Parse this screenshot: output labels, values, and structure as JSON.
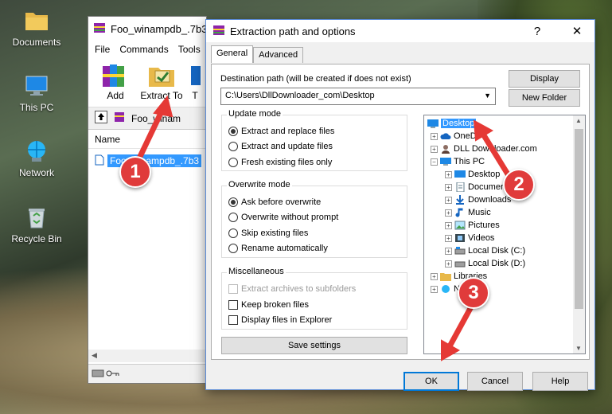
{
  "desktop": {
    "icons": [
      {
        "label": "Documents",
        "icon": "folder-documents-icon"
      },
      {
        "label": "This PC",
        "icon": "computer-icon"
      },
      {
        "label": "Network",
        "icon": "network-icon"
      },
      {
        "label": "Recycle Bin",
        "icon": "recycle-bin-icon"
      }
    ]
  },
  "winrar": {
    "title": "Foo_winampdb_.7b3",
    "menu": [
      "File",
      "Commands",
      "Tools"
    ],
    "toolbar": [
      {
        "label": "Add"
      },
      {
        "label": "Extract To"
      },
      {
        "label": "T"
      }
    ],
    "path": "Foo_winam",
    "column_name": "Name",
    "file": "Foo_winampdb_.7b3"
  },
  "dialog": {
    "title": "Extraction path and options",
    "help": "?",
    "close": "✕",
    "tabs": [
      "General",
      "Advanced"
    ],
    "dest_label": "Destination path (will be created if does not exist)",
    "dest_value": "C:\\Users\\DllDownloader_com\\Desktop",
    "display_btn": "Display",
    "new_folder_btn": "New Folder",
    "update_mode": {
      "title": "Update mode",
      "options": [
        "Extract and replace files",
        "Extract and update files",
        "Fresh existing files only"
      ],
      "selected": 0
    },
    "overwrite_mode": {
      "title": "Overwrite mode",
      "options": [
        "Ask before overwrite",
        "Overwrite without prompt",
        "Skip existing files",
        "Rename automatically"
      ],
      "selected": 0
    },
    "misc": {
      "title": "Miscellaneous",
      "options": [
        "Extract archives to subfolders",
        "Keep broken files",
        "Display files in Explorer"
      ]
    },
    "save_settings": "Save settings",
    "tree": [
      {
        "label": "Desktop",
        "selected": true
      },
      {
        "label": "OneDr"
      },
      {
        "label": "DLL Downloader.com"
      },
      {
        "label": "This PC"
      },
      {
        "label": "Desktop"
      },
      {
        "label": "Document"
      },
      {
        "label": "Downloads"
      },
      {
        "label": "Music"
      },
      {
        "label": "Pictures"
      },
      {
        "label": "Videos"
      },
      {
        "label": "Local Disk (C:)"
      },
      {
        "label": "Local Disk (D:)"
      },
      {
        "label": "Libraries"
      },
      {
        "label": "Net"
      }
    ],
    "ok": "OK",
    "cancel": "Cancel",
    "help_btn": "Help"
  },
  "callouts": [
    "1",
    "2",
    "3"
  ],
  "colors": {
    "accent": "#3399ff",
    "callout": "#e03b3b",
    "arrow": "#e53935"
  }
}
